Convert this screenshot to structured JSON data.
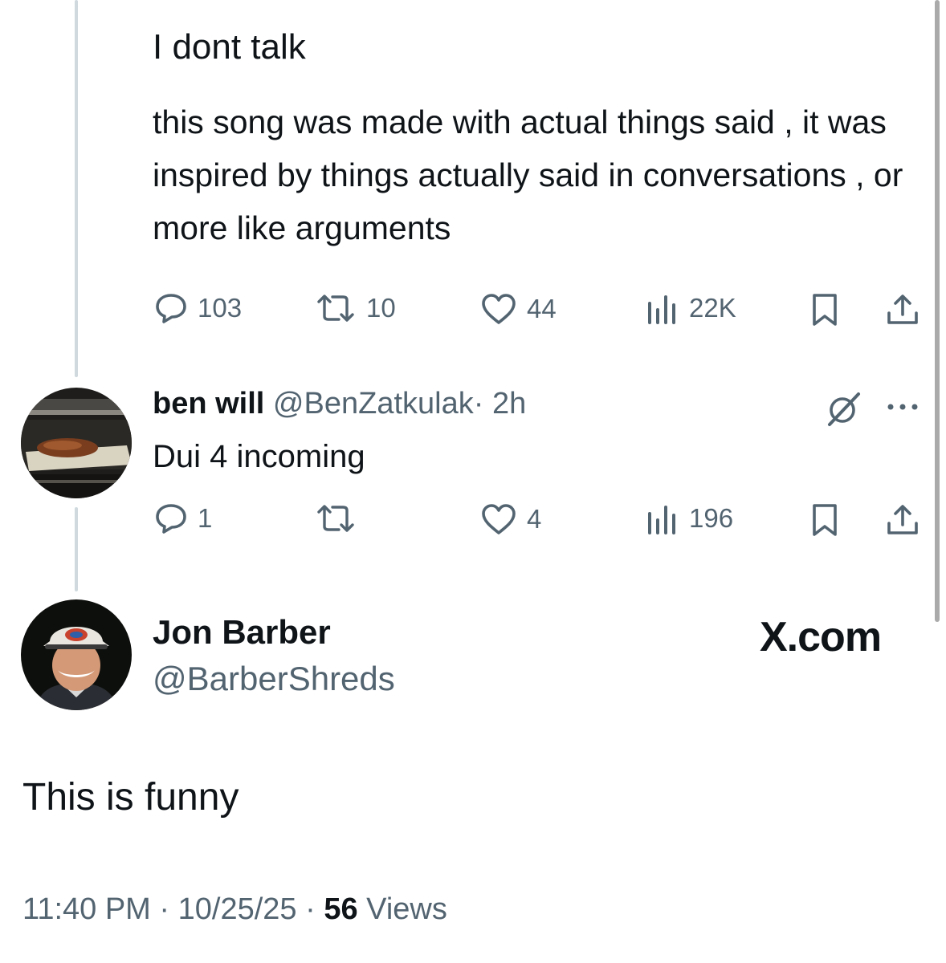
{
  "parent_post": {
    "text_line1": "I dont talk",
    "text_para": "this song was made with actual things said , it was inspired by things actually said in conversations , or more like arguments",
    "replies": "103",
    "reposts": "10",
    "likes": "44",
    "views": "22K"
  },
  "reply_post": {
    "display_name": "ben will",
    "handle": "@BenZatkulak",
    "separator": "·",
    "time": "2h",
    "text": "Dui 4 incoming",
    "replies": "1",
    "reposts": "",
    "likes": "4",
    "views": "196"
  },
  "quote_card": {
    "display_name": "Jon Barber",
    "handle": "@BarberShreds",
    "brand": "X.com",
    "text": "This is funny",
    "time": "11:40 PM",
    "sep1": "·",
    "date": "10/25/25",
    "sep2": "·",
    "views_count": "56",
    "views_label": "Views"
  },
  "icons": {
    "reply": "speech-bubble-icon",
    "repost": "repost-arrows-icon",
    "like": "heart-icon",
    "views": "bar-chart-icon",
    "bookmark": "bookmark-icon",
    "share": "share-upload-icon",
    "grok": "grok-slash-circle-icon",
    "more": "more-dots-icon"
  },
  "colors": {
    "text": "#0f1419",
    "secondary": "#536471",
    "thread_line": "#cfd9de"
  }
}
